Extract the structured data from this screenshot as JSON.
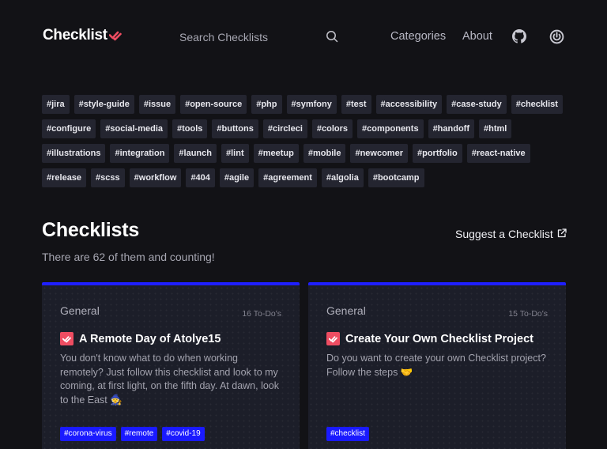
{
  "header": {
    "logo_text": "Checklist",
    "search_placeholder": "Search Checklists",
    "nav": {
      "categories": "Categories",
      "about": "About"
    }
  },
  "tags": [
    "#jira",
    "#style-guide",
    "#issue",
    "#open-source",
    "#php",
    "#symfony",
    "#test",
    "#accessibility",
    "#case-study",
    "#checklist",
    "#configure",
    "#social-media",
    "#tools",
    "#buttons",
    "#circleci",
    "#colors",
    "#components",
    "#handoff",
    "#html",
    "#illustrations",
    "#integration",
    "#launch",
    "#lint",
    "#meetup",
    "#mobile",
    "#newcomer",
    "#portfolio",
    "#react-native",
    "#release",
    "#scss",
    "#workflow",
    "#404",
    "#agile",
    "#agreement",
    "#algolia",
    "#bootcamp"
  ],
  "section": {
    "title": "Checklists",
    "subtitle": "There are 62 of them and counting!",
    "suggest": "Suggest a Checklist"
  },
  "cards": [
    {
      "category": "General",
      "count": "16 To-Do's",
      "title": "A Remote Day of Atolye15",
      "description": "You don't know what to do when working remotely? Just follow this checklist and look to my coming, at first light, on the fifth day. At dawn, look to the East 🧙",
      "tags": [
        "#corona-virus",
        "#remote",
        "#covid-19"
      ]
    },
    {
      "category": "General",
      "count": "15 To-Do's",
      "title": "Create Your Own Checklist Project",
      "description": "Do you want to create your own Checklist project? Follow the steps 🤝",
      "tags": [
        "#checklist"
      ]
    }
  ],
  "colors": {
    "accent": "#1f1fff",
    "brand_red": "#ef4d62",
    "background": "#121216"
  }
}
